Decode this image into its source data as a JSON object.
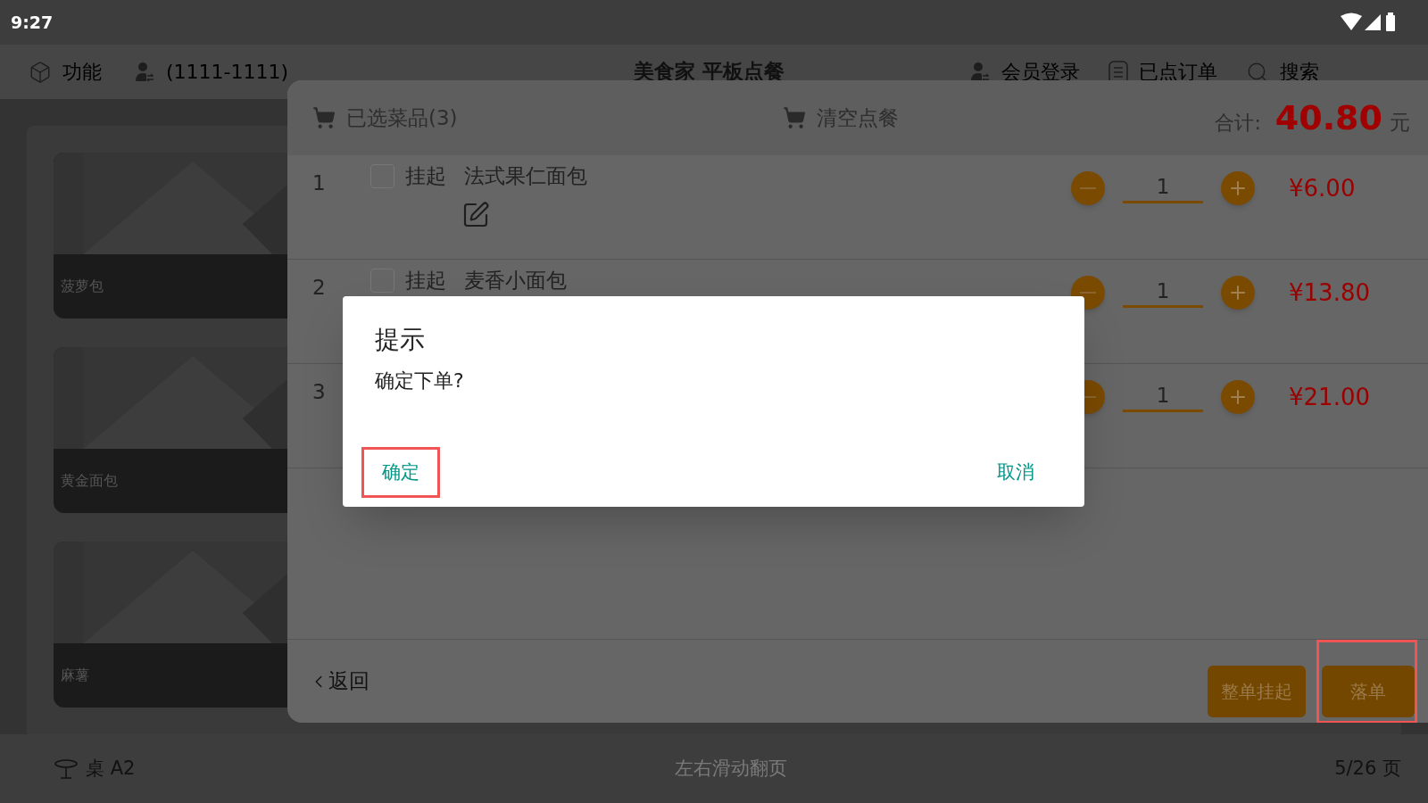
{
  "status_bar": {
    "time": "9:27"
  },
  "top_bar": {
    "left": [
      {
        "label": "功能"
      },
      {
        "label": "(1111-1111)"
      }
    ],
    "title": "美食家 平板点餐",
    "right": [
      {
        "label": "会员登录"
      },
      {
        "label": "已点订单"
      },
      {
        "label": "搜索"
      }
    ]
  },
  "products": [
    {
      "name": "菠萝包"
    },
    {
      "name": "黄金面包"
    },
    {
      "name": "麻薯"
    }
  ],
  "cart": {
    "title": "已选菜品(3)",
    "clear": "清空点餐",
    "total_label": "合计:",
    "total": "40.80",
    "currency": "元",
    "items": [
      {
        "index": "1",
        "hold": {
          "checked": false,
          "label": "挂起"
        },
        "name": "法式果仁面包",
        "has_note": true,
        "quantity": "1",
        "price": "¥6.00"
      },
      {
        "index": "2",
        "hold": {
          "checked": false,
          "label": "挂起"
        },
        "name": "麦香小面包",
        "has_note": false,
        "quantity": "1",
        "price": "¥13.80"
      },
      {
        "index": "3",
        "quantity": "1",
        "price": "¥21.00",
        "has_note": false
      }
    ],
    "back": "返回",
    "buttons": [
      {
        "label": "整单挂起",
        "highlighted": false
      },
      {
        "label": "落单",
        "highlighted": true
      }
    ]
  },
  "dialog": {
    "title": "提示",
    "message": "确定下单?",
    "confirm": {
      "label": "确定",
      "highlighted": true
    },
    "cancel": {
      "label": "取消",
      "highlighted": false
    }
  },
  "bottom_bar": {
    "table": "桌 A2",
    "hint": "左右滑动翻页",
    "page": "5/26 页"
  }
}
